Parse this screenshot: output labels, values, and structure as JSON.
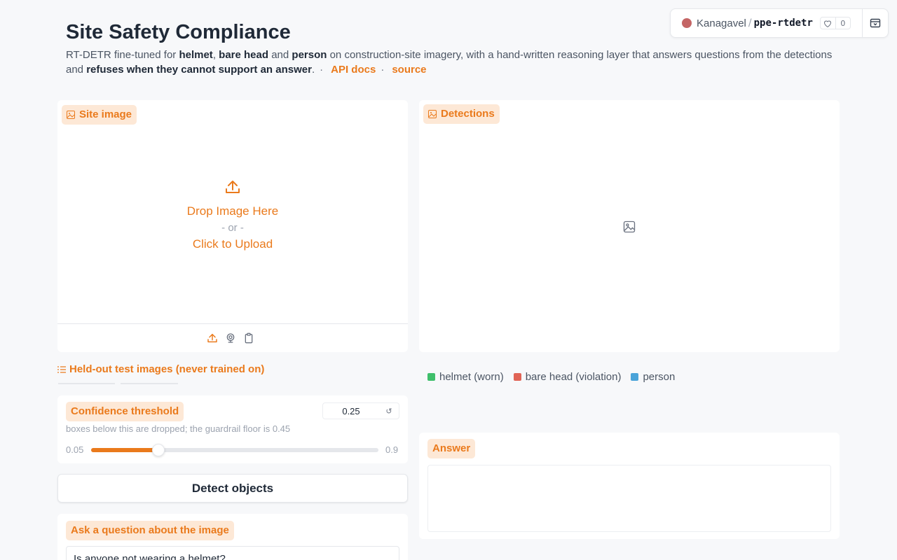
{
  "space": {
    "owner": "Kanagavel",
    "separator": "/",
    "repo": "ppe-rtdetr",
    "likes": "0"
  },
  "header": {
    "title": "Site Safety Compliance",
    "desc_1": "RT-DETR fine-tuned for ",
    "desc_helmet": "helmet",
    "desc_2": ", ",
    "desc_bare": "bare head",
    "desc_3": " and ",
    "desc_person": "person",
    "desc_4": " on construction-site imagery, with a hand-written reasoning layer that answers questions from the detections and ",
    "desc_refuses": "refuses when they cannot support an answer",
    "desc_5": ".",
    "bullet": "·",
    "api_docs": "API docs",
    "source": "source"
  },
  "site_image": {
    "label": "Site image",
    "drop": "Drop Image Here",
    "or": "- or -",
    "click": "Click to Upload"
  },
  "detections": {
    "label": "Detections"
  },
  "held_out": {
    "label": "Held-out test images (never trained on)"
  },
  "legend": [
    {
      "label": "helmet (worn)",
      "color": "#3fbf6b"
    },
    {
      "label": "bare head (violation)",
      "color": "#e06456"
    },
    {
      "label": "person",
      "color": "#4aa3d9"
    }
  ],
  "confidence": {
    "label": "Confidence threshold",
    "value": "0.25",
    "info": "boxes below this are dropped; the guardrail floor is 0.45",
    "min": "0.05",
    "max": "0.9",
    "fraction": 0.235
  },
  "detect_button": "Detect objects",
  "ask": {
    "label": "Ask a question about the image",
    "question": "Is anyone not wearing a helmet?"
  },
  "answer": {
    "label": "Answer",
    "text": ""
  },
  "colors": {
    "accent": "#ea7a1c",
    "accent_bg": "#fde8d6"
  }
}
